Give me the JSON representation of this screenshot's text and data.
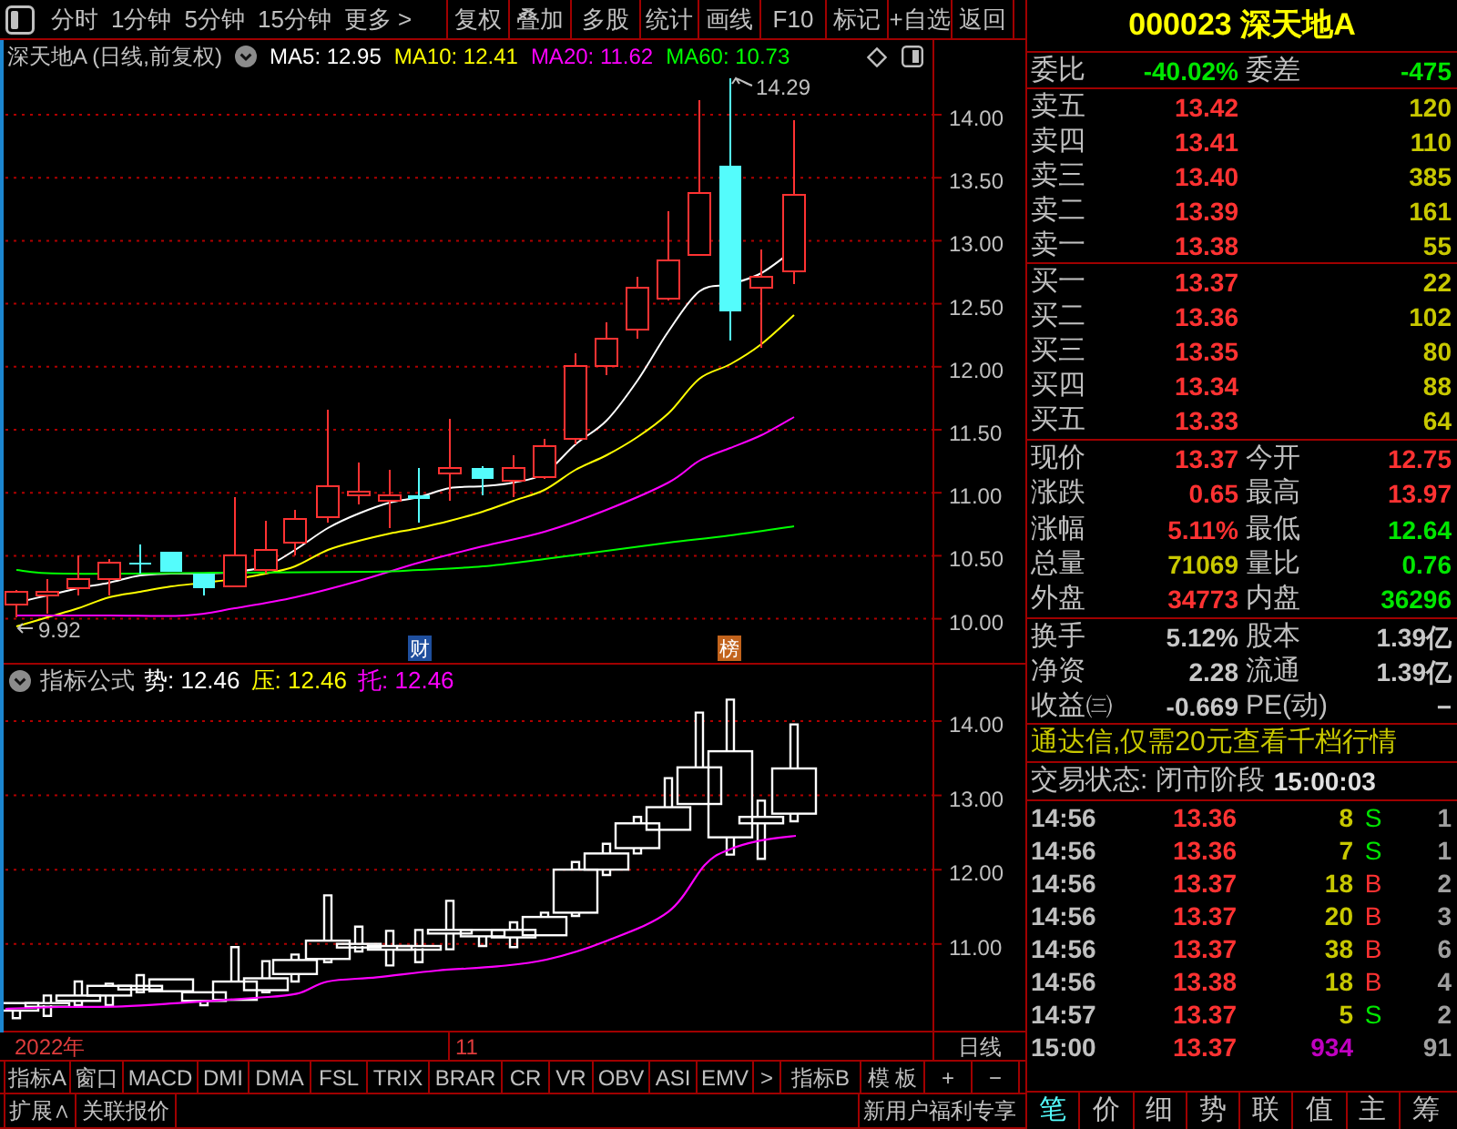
{
  "toolbar": {
    "periods": [
      "分时",
      "1分钟",
      "5分钟",
      "15分钟",
      "更多 >"
    ],
    "buttons": [
      "复权",
      "叠加",
      "多股",
      "统计",
      "画线",
      "F10",
      "标记",
      "+自选",
      "返回"
    ]
  },
  "chart_header": {
    "title": "深天地A (日线,前复权)",
    "indicators": [
      {
        "text": "MA5: 12.95",
        "color": "#ffffff"
      },
      {
        "text": "MA10: 12.41",
        "color": "#ffff00"
      },
      {
        "text": "MA20: 11.62",
        "color": "#ff00ff"
      },
      {
        "text": "MA60: 10.73",
        "color": "#00ff00"
      }
    ]
  },
  "main_chart": {
    "y_labels": [
      "14.00",
      "13.50",
      "13.00",
      "12.50",
      "12.00",
      "11.50",
      "11.00",
      "10.50",
      "10.00"
    ],
    "high_label": "14.29",
    "low_label": "9.92",
    "markers": [
      {
        "text": "财",
        "color": "#1f4f9e"
      },
      {
        "text": "榜",
        "color": "#c2631c"
      }
    ]
  },
  "indicator_panel": {
    "title": "指标公式",
    "values": [
      {
        "text": "势: 12.46",
        "color": "#ffffff"
      },
      {
        "text": "压: 12.46",
        "color": "#ffff00"
      },
      {
        "text": "托: 12.46",
        "color": "#ff00ff"
      }
    ],
    "y_labels": [
      "14.00",
      "13.00",
      "12.00",
      "11.00"
    ]
  },
  "date_axis": {
    "labels": [
      "2022年",
      "11"
    ],
    "period": "日线"
  },
  "indicator_tabs": [
    "指标A",
    "窗口",
    "MACD",
    "DMI",
    "DMA",
    "FSL",
    "TRIX",
    "BRAR",
    "CR",
    "VR",
    "OBV",
    "ASI",
    "EMV",
    ">",
    "指标B",
    "模 板",
    "+",
    "−"
  ],
  "bottom_bar": {
    "links": [
      "扩展∧",
      "关联报价"
    ],
    "promo": "新用户福利专享"
  },
  "quote": {
    "title": "000023 深天地A",
    "commission": [
      {
        "label": "委比",
        "value": "-40.02%"
      },
      {
        "label": "委差",
        "value": "-475"
      }
    ],
    "asks": [
      {
        "label": "卖五",
        "price": "13.42",
        "volume": "120"
      },
      {
        "label": "卖四",
        "price": "13.41",
        "volume": "110"
      },
      {
        "label": "卖三",
        "price": "13.40",
        "volume": "385"
      },
      {
        "label": "卖二",
        "price": "13.39",
        "volume": "161"
      },
      {
        "label": "卖一",
        "price": "13.38",
        "volume": "55"
      }
    ],
    "bids": [
      {
        "label": "买一",
        "price": "13.37",
        "volume": "22"
      },
      {
        "label": "买二",
        "price": "13.36",
        "volume": "102"
      },
      {
        "label": "买三",
        "price": "13.35",
        "volume": "80"
      },
      {
        "label": "买四",
        "price": "13.34",
        "volume": "88"
      },
      {
        "label": "买五",
        "price": "13.33",
        "volume": "64"
      }
    ],
    "stats": [
      {
        "label": "现价",
        "value": "13.37",
        "color": "#ff3232"
      },
      {
        "label": "今开",
        "value": "12.75",
        "color": "#ff3232"
      },
      {
        "label": "涨跌",
        "value": "0.65",
        "color": "#ff3232"
      },
      {
        "label": "最高",
        "value": "13.97",
        "color": "#ff3232"
      },
      {
        "label": "涨幅",
        "value": "5.11%",
        "color": "#ff3232"
      },
      {
        "label": "最低",
        "value": "12.64",
        "color": "#00e600"
      },
      {
        "label": "总量",
        "value": "71069",
        "color": "#c8c800"
      },
      {
        "label": "量比",
        "value": "0.76",
        "color": "#00e600"
      },
      {
        "label": "外盘",
        "value": "34773",
        "color": "#ff3232"
      },
      {
        "label": "内盘",
        "value": "36296",
        "color": "#00e600"
      }
    ],
    "fundamentals": [
      {
        "label": "换手",
        "value": "5.12%"
      },
      {
        "label": "股本",
        "value": "1.39亿"
      },
      {
        "label": "净资",
        "value": "2.28"
      },
      {
        "label": "流通",
        "value": "1.39亿"
      },
      {
        "label": "收益㈢",
        "value": "-0.669"
      },
      {
        "label": "PE(动)",
        "value": "−"
      }
    ],
    "promo": "通达信,仅需20元查看千档行情",
    "trade_status": {
      "text": "交易状态: 闭市阶段",
      "time": "15:00:03"
    },
    "ticks": [
      {
        "time": "14:56",
        "price": "13.36",
        "volume": "8",
        "side": "S",
        "count": "1",
        "kind": "sell"
      },
      {
        "time": "14:56",
        "price": "13.36",
        "volume": "7",
        "side": "S",
        "count": "1",
        "kind": "sell"
      },
      {
        "time": "14:56",
        "price": "13.37",
        "volume": "18",
        "side": "B",
        "count": "2",
        "kind": "buy"
      },
      {
        "time": "14:56",
        "price": "13.37",
        "volume": "20",
        "side": "B",
        "count": "3",
        "kind": "buy"
      },
      {
        "time": "14:56",
        "price": "13.37",
        "volume": "38",
        "side": "B",
        "count": "6",
        "kind": "buy"
      },
      {
        "time": "14:56",
        "price": "13.38",
        "volume": "18",
        "side": "B",
        "count": "4",
        "kind": "buy"
      },
      {
        "time": "14:57",
        "price": "13.37",
        "volume": "5",
        "side": "S",
        "count": "2",
        "kind": "sell"
      },
      {
        "time": "15:00",
        "price": "13.37",
        "volume": "934",
        "count": "91",
        "kind": "summary"
      }
    ],
    "tabs": [
      {
        "label": "笔",
        "selected": true
      },
      {
        "label": "价",
        "selected": false
      },
      {
        "label": "细",
        "selected": false
      },
      {
        "label": "势",
        "selected": false
      },
      {
        "label": "联",
        "selected": false
      },
      {
        "label": "值",
        "selected": false
      },
      {
        "label": "主",
        "selected": false
      },
      {
        "label": "筹",
        "selected": false
      }
    ]
  }
}
